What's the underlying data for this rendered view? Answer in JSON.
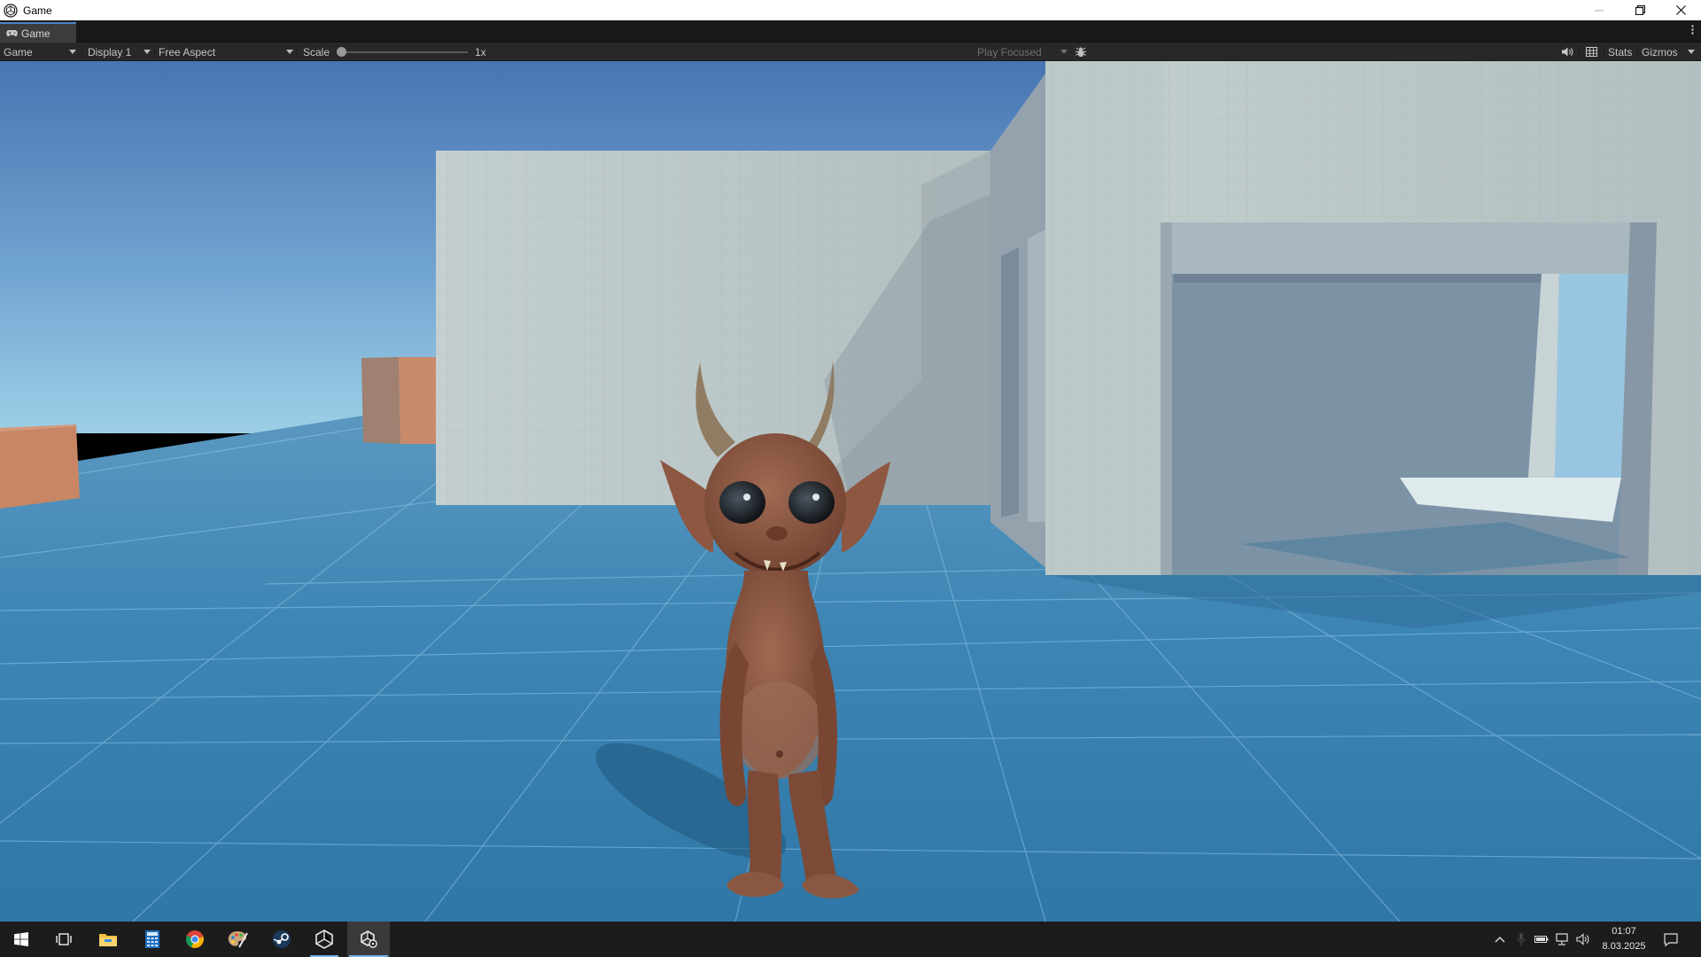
{
  "window": {
    "title": "Game",
    "icon": "unity-icon",
    "controls": [
      "minimize-icon",
      "restore-icon",
      "close-icon"
    ]
  },
  "tab": {
    "label": "Game",
    "icon": "gamepad-icon",
    "menu_icon": "more-vertical-icon"
  },
  "toolbar": {
    "mode_dropdown": "Game",
    "display_dropdown": "Display 1",
    "aspect_dropdown": "Free Aspect",
    "scale_label": "Scale",
    "scale_value": "1x",
    "scale_slider_position": 0,
    "play_mode_dropdown": "Play Focused",
    "bug_icon": "bug-icon",
    "audio_icon": "speaker-icon",
    "grid_icon": "grid-icon",
    "stats_label": "Stats",
    "gizmos_label": "Gizmos"
  },
  "taskbar": {
    "apps": [
      "windows-start-icon",
      "task-view-icon",
      "file-explorer-icon",
      "calculator-icon",
      "chrome-icon",
      "paint-palette-icon",
      "steam-icon",
      "unity-hub-icon",
      "unity-editor-icon"
    ],
    "tray": [
      "chevron-up-icon",
      "microphone-icon",
      "battery-icon",
      "network-icon",
      "volume-icon"
    ],
    "time": "01:07",
    "date": "8.03.2025",
    "notification_icon": "notification-icon"
  },
  "colors": {
    "accent": "#4a85c6",
    "sky_top": "#4a79b5",
    "sky_horizon": "#8fc3e0",
    "floor": "#3a82b0",
    "wall": "#b8c4c4",
    "character_skin": "#8a5640"
  }
}
